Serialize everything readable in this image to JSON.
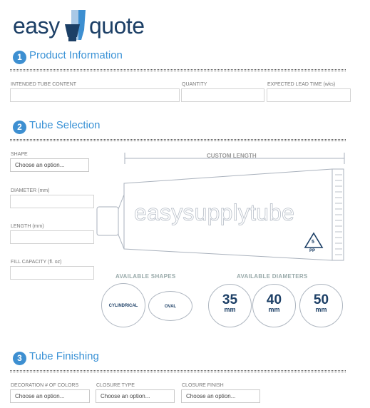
{
  "logo": {
    "part1": "easy",
    "part2": "quote"
  },
  "sections": {
    "product": {
      "num": "1",
      "title": "Product Information"
    },
    "tube": {
      "num": "2",
      "title": "Tube Selection"
    },
    "finish": {
      "num": "3",
      "title": "Tube Finishing"
    }
  },
  "product_info": {
    "content_label": "INTENDED TUBE CONTENT",
    "quantity_label": "QUANTITY",
    "lead_label": "EXPECTED LEAD TIME (wks)"
  },
  "tube_selection": {
    "shape_label": "SHAPE",
    "shape_value": "Choose an option...",
    "diameter_label": "DIAMETER (mm)",
    "length_label": "LENGTH (mm)",
    "fill_label": "FILL CAPACITY (fl. oz)",
    "custom_length": "CUSTOM LENGTH",
    "tube_text": "easysupplytube",
    "recycle_num": "5",
    "recycle_code": "PP",
    "available_shapes": "AVAILABLE SHAPES",
    "available_diameters": "AVAILABLE DIAMETERS",
    "shapes": [
      "CYLINDRICAL",
      "OVAL"
    ],
    "diameters": [
      {
        "value": "35",
        "unit": "mm"
      },
      {
        "value": "40",
        "unit": "mm"
      },
      {
        "value": "50",
        "unit": "mm"
      }
    ]
  },
  "finishing": {
    "colors_label": "DECORATION # OF COLORS",
    "colors_value": "Choose an option...",
    "closure_type_label": "CLOSURE TYPE",
    "closure_type_value": "Choose an option...",
    "closure_finish_label": "CLOSURE FINISH",
    "closure_finish_value": "Choose an option..."
  },
  "colors": {
    "accent": "#3a92d6",
    "brand": "#1c3f66"
  }
}
